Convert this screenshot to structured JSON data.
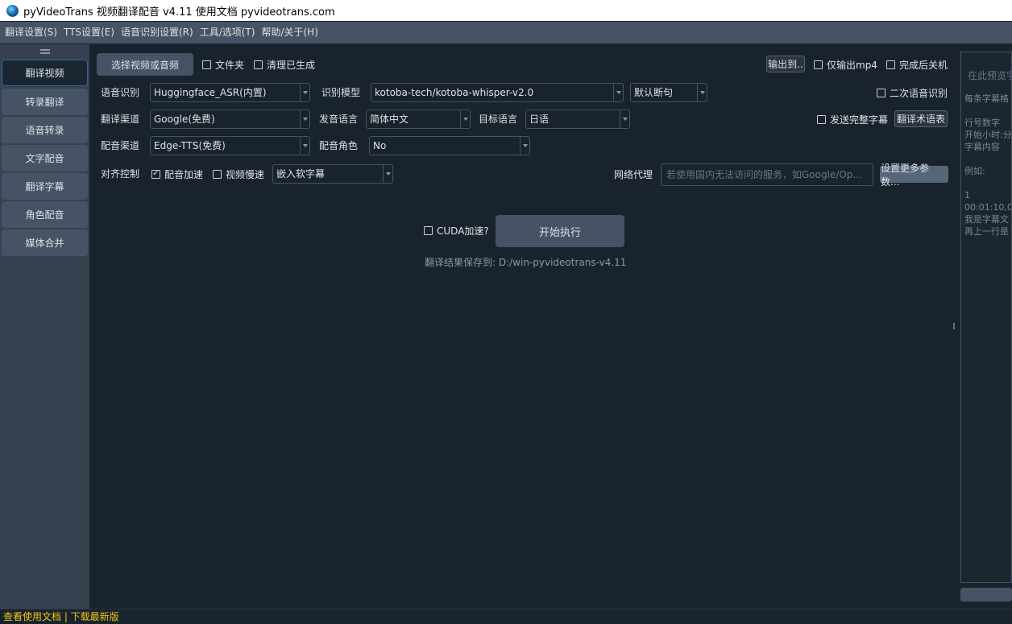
{
  "window": {
    "title": "pyVideoTrans 视频翻译配音 v4.11  使用文档 pyvideotrans.com"
  },
  "menu": [
    "翻译设置(S)",
    "TTS设置(E)",
    "语音识别设置(R)",
    "工具/选项(T)",
    "帮助/关于(H)"
  ],
  "sidebar": {
    "items": [
      {
        "label": "翻译视频",
        "active": true
      },
      {
        "label": "转录翻译"
      },
      {
        "label": "语音转录"
      },
      {
        "label": "文字配音"
      },
      {
        "label": "翻译字幕"
      },
      {
        "label": "角色配音"
      },
      {
        "label": "媒体合并"
      }
    ]
  },
  "toolbar": {
    "select_button": "选择视频或音频",
    "folder_checkbox": "文件夹",
    "clear_checkbox": "清理已生成",
    "output_button": "输出到..",
    "mp4_only_checkbox": "仅输出mp4",
    "shutdown_checkbox": "完成后关机"
  },
  "asr": {
    "label": "语音识别",
    "value": "Huggingface_ASR(内置)",
    "model_label": "识别模型",
    "model_value": "kotoba-tech/kotoba-whisper-v2.0",
    "split_value": "默认断句",
    "second_pass_checkbox": "二次语音识别"
  },
  "translate": {
    "label": "翻译渠道",
    "value": "Google(免费)",
    "source_lang_label": "发音语言",
    "source_lang_value": "简体中文",
    "target_lang_label": "目标语言",
    "target_lang_value": "日语",
    "send_full_checkbox": "发送完整字幕",
    "glossary_button": "翻译术语表"
  },
  "dubbing": {
    "label": "配音渠道",
    "value": "Edge-TTS(免费)",
    "role_label": "配音角色",
    "role_value": "No"
  },
  "align": {
    "label": "对齐控制",
    "speedup_checkbox": "配音加速",
    "speedup_checked": true,
    "slowdown_checkbox": "视频慢速",
    "subtitle_value": "嵌入软字幕",
    "proxy_label": "网络代理",
    "proxy_placeholder": "若使用国内无法访问的服务，如Google/Op...",
    "more_params_button": "设置更多参数..."
  },
  "run": {
    "cuda_checkbox": "CUDA加速?",
    "start_button": "开始执行",
    "save_path_note": "翻译结果保存到: D:/win-pyvideotrans-v4.11"
  },
  "preview": {
    "placeholder": "在此预览字",
    "guide": "每条字幕格\n\n行号数字\n开始小时:分\n字幕内容\n\n例如:\n\n1\n00:01:10,0\n我是字幕文\n再上一行是"
  },
  "status": {
    "text": "查看使用文档 | 下载最新版"
  },
  "colors": {
    "background": "#19232d",
    "panel": "#455364",
    "accent": "#346792",
    "status": "#f1c40f"
  }
}
